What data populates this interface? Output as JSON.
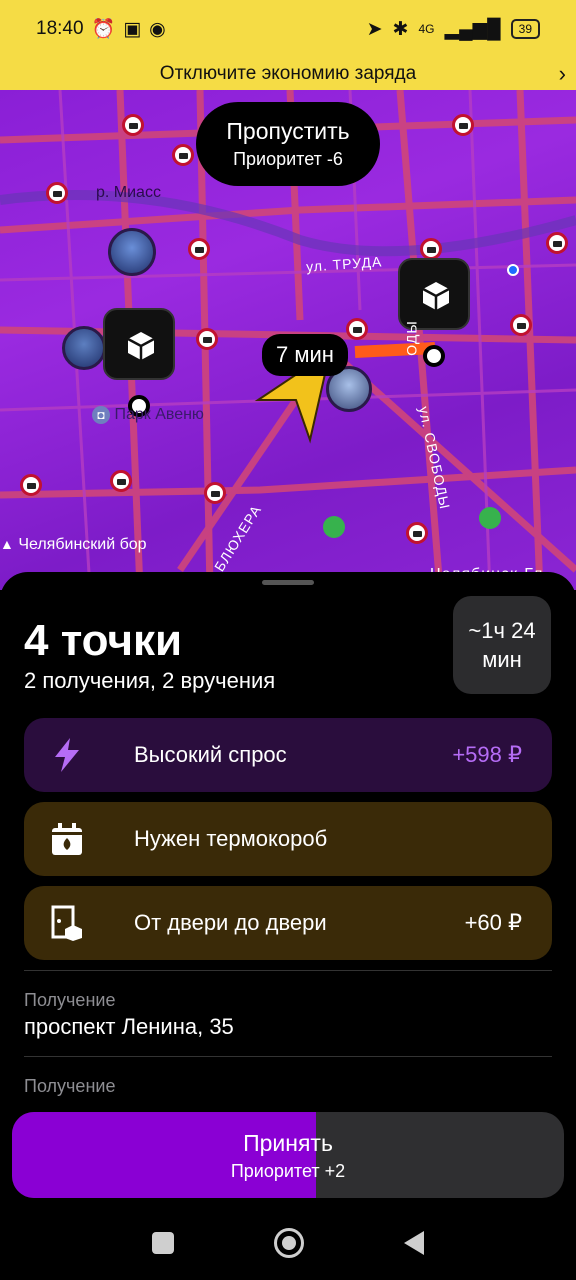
{
  "status_bar": {
    "time": "18:40",
    "network": "4G",
    "battery": "39"
  },
  "banner": {
    "text": "Отключите экономию заряда"
  },
  "map": {
    "skip": {
      "title": "Пропустить",
      "subtitle": "Приоритет -6"
    },
    "eta": "7 мин",
    "labels": {
      "river": "р. Миасс",
      "mall": "Парк Авеню",
      "forest": "Челябинский бор",
      "trudа": "ул. ТРУДА",
      "svobody": "ул. СВОБОДЫ",
      "svobody2": "ОДЫ",
      "blukhera": "БЛЮХЕРА",
      "station": "Челябинск-Гл"
    }
  },
  "order": {
    "title": "4 точки",
    "subtitle": "2 получения, 2 вручения",
    "duration": "~1ч 24 мин",
    "tags": [
      {
        "icon": "lightning-icon",
        "label": "Высокий спрос",
        "amount": "+598 ₽"
      },
      {
        "icon": "thermobox-icon",
        "label": "Нужен термокороб",
        "amount": ""
      },
      {
        "icon": "door-icon",
        "label": "От двери до двери",
        "amount": "+60 ₽"
      }
    ],
    "points": [
      {
        "label": "Получение",
        "address": "проспект Ленина, 35"
      },
      {
        "label": "Получение",
        "address": ""
      }
    ]
  },
  "accept": {
    "title": "Принять",
    "subtitle": "Приоритет +2",
    "progress": 0.55
  },
  "colors": {
    "accent": "#8a00d4",
    "banner": "#f5dc45",
    "demand_amount": "#b56cf5"
  }
}
